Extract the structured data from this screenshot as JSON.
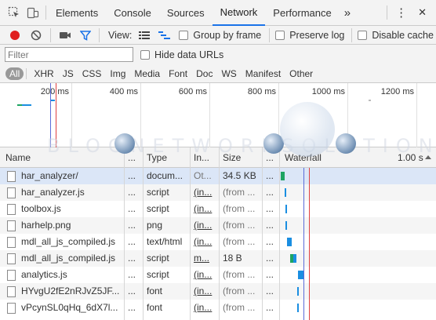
{
  "tabs": {
    "items": [
      "Elements",
      "Console",
      "Sources",
      "Network",
      "Performance"
    ],
    "active": "Network",
    "more": "»",
    "menu": "⋮",
    "close": "✕"
  },
  "toolbar": {
    "view_label": "View:",
    "group_by_frame": "Group by frame",
    "preserve_log": "Preserve log",
    "disable_cache": "Disable cache"
  },
  "filter": {
    "placeholder": "Filter",
    "hide_data_urls": "Hide data URLs"
  },
  "types": [
    "All",
    "XHR",
    "JS",
    "CSS",
    "Img",
    "Media",
    "Font",
    "Doc",
    "WS",
    "Manifest",
    "Other"
  ],
  "overview": {
    "ticks": [
      "200 ms",
      "400 ms",
      "600 ms",
      "800 ms",
      "1000 ms",
      "1200 ms"
    ]
  },
  "table": {
    "headers": {
      "name": "Name",
      "col2": "...",
      "type": "Type",
      "initiator": "In...",
      "size": "Size",
      "col6": "...",
      "waterfall": "Waterfall",
      "waterfall_time": "1.00 s"
    },
    "rows": [
      {
        "name": "har_analyzer/",
        "col2": "...",
        "type": "docum...",
        "initiator": "Ot...",
        "size": "34.5 KB",
        "col6": "..."
      },
      {
        "name": "har_analyzer.js",
        "col2": "...",
        "type": "script",
        "initiator": "(in...",
        "size": "(from ...",
        "col6": "..."
      },
      {
        "name": "toolbox.js",
        "col2": "...",
        "type": "script",
        "initiator": "(in...",
        "size": "(from ...",
        "col6": "..."
      },
      {
        "name": "harhelp.png",
        "col2": "...",
        "type": "png",
        "initiator": "(in...",
        "size": "(from ...",
        "col6": "..."
      },
      {
        "name": "mdl_all_js_compiled.js",
        "col2": "...",
        "type": "text/html",
        "initiator": "(in...",
        "size": "(from ...",
        "col6": "..."
      },
      {
        "name": "mdl_all_js_compiled.js",
        "col2": "...",
        "type": "script",
        "initiator": "m...",
        "size": "18 B",
        "col6": "..."
      },
      {
        "name": "analytics.js",
        "col2": "...",
        "type": "script",
        "initiator": "(in...",
        "size": "(from ...",
        "col6": "..."
      },
      {
        "name": "HYvgU2fE2nRJvZ5JF...",
        "col2": "...",
        "type": "font",
        "initiator": "(in...",
        "size": "(from ...",
        "col6": "..."
      },
      {
        "name": "vPcynSL0qHq_6dX7l...",
        "col2": "...",
        "type": "font",
        "initiator": "(in...",
        "size": "(from ...",
        "col6": "..."
      }
    ]
  },
  "watermark": "BLOGNETWORKSOLUTION",
  "colors": {
    "accent": "#1a73e8",
    "record": "#e01e1e",
    "selected_row": "#dbe6f7",
    "waterfall_green": "#1da462",
    "waterfall_blue": "#1a8ee1"
  }
}
